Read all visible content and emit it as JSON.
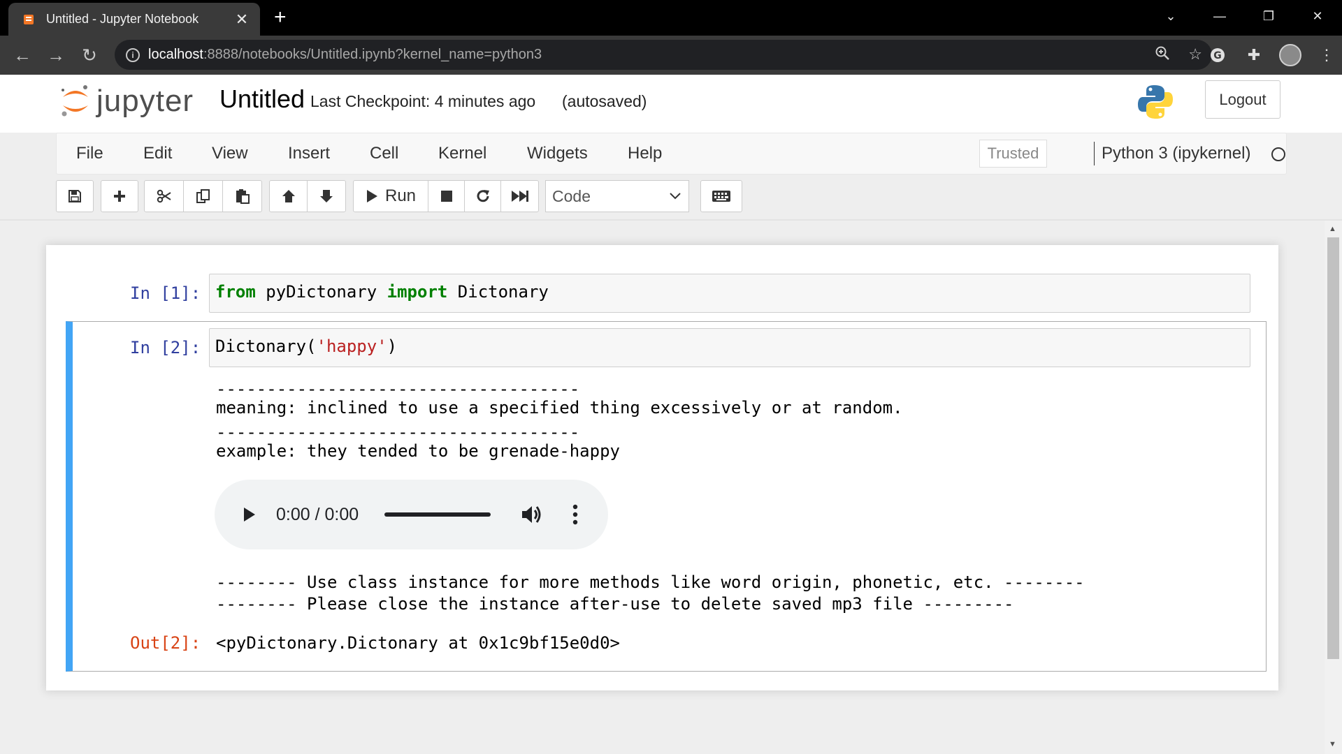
{
  "browser": {
    "tab_title": "Untitled - Jupyter Notebook",
    "tab_close": "✕",
    "new_tab": "+",
    "url_host": "localhost",
    "url_rest": ":8888/notebooks/Untitled.ipynb?kernel_name=python3"
  },
  "header": {
    "logo_text": "jupyter",
    "notebook_name": "Untitled",
    "checkpoint": "Last Checkpoint: 4 minutes ago",
    "autosave": "(autosaved)",
    "logout_label": "Logout"
  },
  "menubar": {
    "items": [
      "File",
      "Edit",
      "View",
      "Insert",
      "Cell",
      "Kernel",
      "Widgets",
      "Help"
    ],
    "trusted_label": "Trusted",
    "kernel_name": "Python 3 (ipykernel)"
  },
  "toolbar": {
    "run_label": "Run",
    "cell_type": "Code"
  },
  "cells": [
    {
      "prompt": "In [1]:",
      "code_parts": [
        "from",
        " pyDictonary ",
        "import",
        " Dictonary"
      ]
    },
    {
      "prompt": "In [2]:",
      "code_parts": [
        "Dictonary(",
        "'happy'",
        ")"
      ],
      "stdout": [
        "------------------------------------",
        "meaning: inclined to use a specified thing excessively or at random.",
        "------------------------------------",
        "example: they tended to be grenade-happy"
      ],
      "audio_time": "0:00 / 0:00",
      "stdout_after": [
        "-------- Use class instance for more methods like word origin, phonetic, etc. --------",
        "-------- Please close the instance after-use to delete saved mp3 file ---------"
      ],
      "out_prompt": "Out[2]:",
      "result": "<pyDictonary.Dictonary at 0x1c9bf15e0d0>"
    }
  ],
  "colors": {
    "selected_cell_border": "#42a5f5",
    "in_prompt": "#303f9f",
    "out_prompt": "#d84315",
    "keyword": "#008000",
    "string": "#ba2121"
  }
}
